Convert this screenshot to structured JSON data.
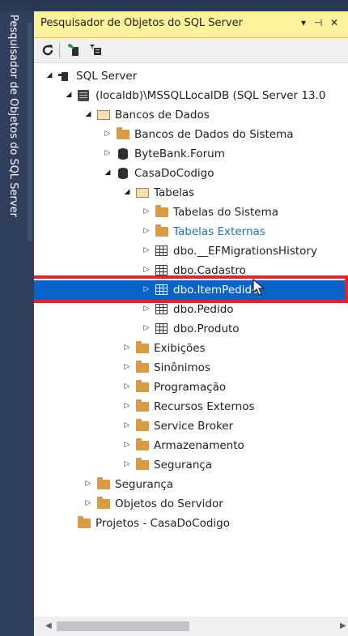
{
  "side_tab": {
    "label": "Pesquisador de Objetos do SQL Server"
  },
  "panel": {
    "title": "Pesquisador de Objetos do SQL Server",
    "title_controls": {
      "dropdown": "▾",
      "pin": "⊣",
      "close": "✕"
    }
  },
  "toolbar": {
    "refresh_icon": "refresh-icon",
    "connect_icon": "connect-icon",
    "filter_icon": "filter-icon"
  },
  "tree": [
    {
      "label": "SQL Server",
      "expander": "◢",
      "icon": "sql-server-icon"
    },
    {
      "label": "(localdb)\\MSSQLLocalDB (SQL Server 13.0",
      "expander": "◢",
      "icon": "server-icon"
    },
    {
      "label": "Bancos de Dados",
      "expander": "◢",
      "icon": "folder-open-icon"
    },
    {
      "label": "Bancos de Dados do Sistema",
      "expander": "▷",
      "icon": "folder-icon"
    },
    {
      "label": "ByteBank.Forum",
      "expander": "▷",
      "icon": "database-icon"
    },
    {
      "label": "CasaDoCodigo",
      "expander": "◢",
      "icon": "database-icon"
    },
    {
      "label": "Tabelas",
      "expander": "◢",
      "icon": "folder-open-icon"
    },
    {
      "label": "Tabelas do Sistema",
      "expander": "▷",
      "icon": "folder-icon"
    },
    {
      "label": "Tabelas Externas",
      "expander": "▷",
      "icon": "folder-icon",
      "color": "#1c6fc9"
    },
    {
      "label": "dbo.__EFMigrationsHistory",
      "expander": "▷",
      "icon": "table-icon"
    },
    {
      "label": "dbo.Cadastro",
      "expander": "▷",
      "icon": "table-icon"
    },
    {
      "label": "dbo.ItemPedido",
      "expander": "▷",
      "icon": "table-icon",
      "selected": true
    },
    {
      "label": "dbo.Pedido",
      "expander": "▷",
      "icon": "table-icon"
    },
    {
      "label": "dbo.Produto",
      "expander": "▷",
      "icon": "table-icon"
    },
    {
      "label": "Exibições",
      "expander": "▷",
      "icon": "folder-icon"
    },
    {
      "label": "Sinônimos",
      "expander": "▷",
      "icon": "folder-icon"
    },
    {
      "label": "Programação",
      "expander": "▷",
      "icon": "folder-icon"
    },
    {
      "label": "Recursos Externos",
      "expander": "▷",
      "icon": "folder-icon"
    },
    {
      "label": "Service Broker",
      "expander": "▷",
      "icon": "folder-icon"
    },
    {
      "label": "Armazenamento",
      "expander": "▷",
      "icon": "folder-icon"
    },
    {
      "label": "Segurança",
      "expander": "▷",
      "icon": "folder-icon"
    },
    {
      "label": "Segurança",
      "expander": "▷",
      "icon": "folder-icon"
    },
    {
      "label": "Objetos do Servidor",
      "expander": "▷",
      "icon": "folder-icon"
    },
    {
      "label": "Projetos - CasaDoCodigo",
      "expander": "",
      "icon": "folder-icon"
    }
  ],
  "scrollbar": {
    "left_arrow": "◀",
    "right_arrow": "▶"
  },
  "colors": {
    "selection": "#0a64c8",
    "highlight": "#e8202a",
    "titlebar": "#fff29d",
    "link": "#1c6fc9"
  }
}
